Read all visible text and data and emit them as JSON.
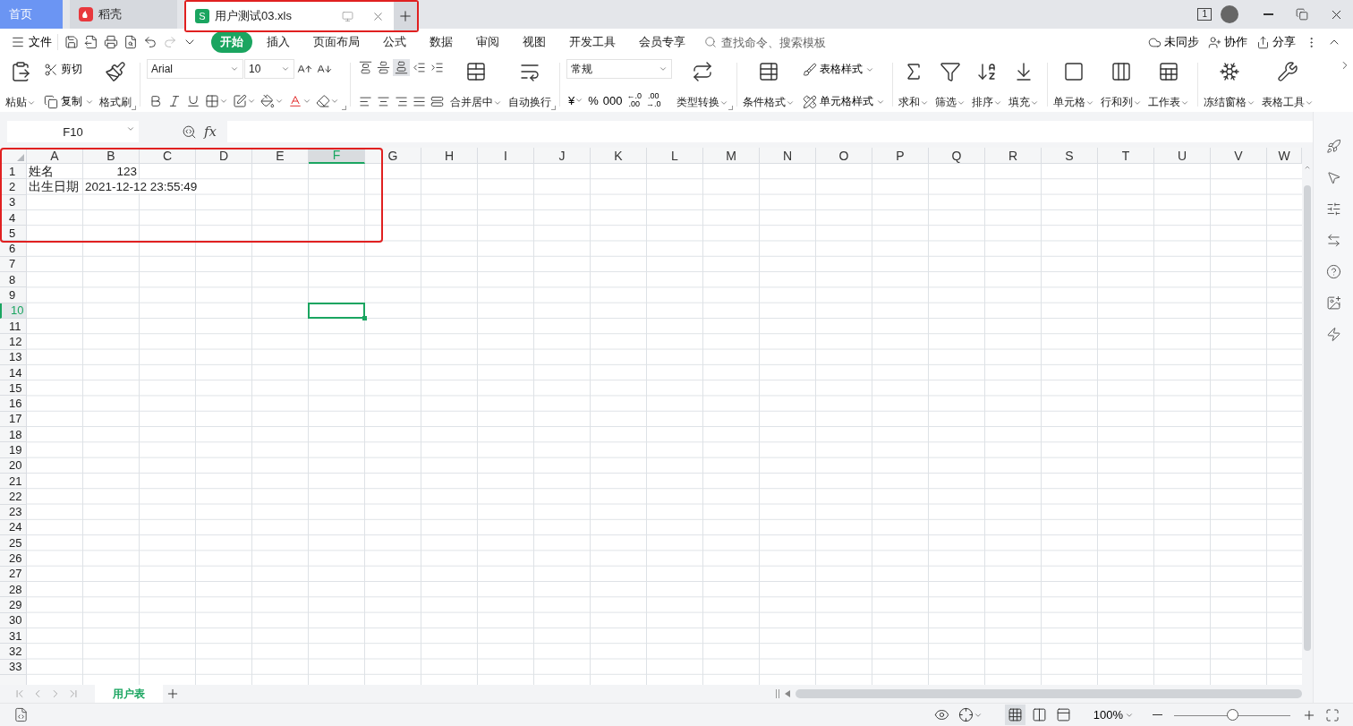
{
  "title_bar": {
    "tabs": [
      {
        "kind": "home",
        "label": "首页",
        "selected": false
      },
      {
        "kind": "docer",
        "label": "稻壳",
        "selected": false
      },
      {
        "kind": "sheet",
        "label": "用户测试03.xls",
        "badge": "S",
        "selected": true
      }
    ],
    "window_count": "1"
  },
  "menu_bar": {
    "file": "文件",
    "quick_access": [
      {
        "disabled": false
      },
      {
        "disabled": false
      },
      {
        "disabled": false
      },
      {
        "disabled": false
      },
      {
        "disabled": false
      },
      {
        "disabled": true
      },
      {
        "disabled": false
      }
    ],
    "tabs": [
      {
        "label": "开始",
        "selected": true
      },
      {
        "label": "插入",
        "selected": false
      },
      {
        "label": "页面布局",
        "selected": false
      },
      {
        "label": "公式",
        "selected": false
      },
      {
        "label": "数据",
        "selected": false
      },
      {
        "label": "审阅",
        "selected": false
      },
      {
        "label": "视图",
        "selected": false
      },
      {
        "label": "开发工具",
        "selected": false
      },
      {
        "label": "会员专享",
        "selected": false
      }
    ],
    "search": {
      "placeholder": "查找命令、搜索模板"
    },
    "actions": [
      {
        "label": "未同步"
      },
      {
        "label": "协作"
      },
      {
        "label": "分享"
      }
    ]
  },
  "ribbon": [
    {
      "kind": "large",
      "label": "粘贴",
      "dropdown": true,
      "launcher": false
    },
    {
      "kind": "pair",
      "items": [
        {
          "label": "剪切",
          "dropdown": false
        },
        {
          "label": "复制",
          "dropdown": true
        }
      ]
    },
    {
      "kind": "large",
      "label": "格式刷",
      "dropdown": false,
      "launcher": true
    },
    {
      "kind": "divider"
    },
    {
      "kind": "font",
      "name": "Arial",
      "size": "10",
      "launcher": true,
      "tools": [
        {
          "dropdown": false
        },
        {
          "dropdown": false
        },
        {
          "dropdown": false
        },
        {
          "dropdown": true
        },
        {
          "dropdown": true
        },
        {
          "dropdown": true
        },
        {
          "dropdown": true
        },
        {
          "dropdown": true
        }
      ]
    },
    {
      "kind": "divider"
    },
    {
      "kind": "align",
      "tools": [
        {
          "selected": false
        },
        {
          "selected": false
        },
        {
          "selected": true
        },
        {
          "selected": false
        },
        {
          "selected": false
        },
        {
          "selected": false
        },
        {
          "selected": false
        },
        {
          "selected": false
        },
        {
          "selected": false
        },
        {
          "selected": false
        }
      ]
    },
    {
      "kind": "large",
      "label": "合并居中",
      "dropdown": true,
      "launcher": false
    },
    {
      "kind": "large",
      "label": "自动换行",
      "dropdown": false,
      "launcher": true
    },
    {
      "kind": "divider"
    },
    {
      "kind": "number",
      "format": "常规",
      "tools": [
        {
          "label": "¥",
          "dropdown": true
        },
        {
          "label": "%",
          "dropdown": false
        },
        {
          "label": "000",
          "dropdown": false
        },
        {
          "label": "←.0",
          "sub": ".00",
          "dropdown": false
        },
        {
          "label": ".00",
          "sub": "→.0",
          "dropdown": false
        }
      ]
    },
    {
      "kind": "large",
      "label": "类型转换",
      "dropdown": true,
      "launcher": true
    },
    {
      "kind": "divider"
    },
    {
      "kind": "large",
      "label": "条件格式",
      "dropdown": true,
      "launcher": false
    },
    {
      "kind": "pair",
      "items": [
        {
          "label": "表格样式",
          "dropdown": true
        },
        {
          "label": "单元格样式",
          "dropdown": true
        }
      ]
    },
    {
      "kind": "divider"
    },
    {
      "kind": "large",
      "label": "求和",
      "dropdown": true,
      "launcher": false
    },
    {
      "kind": "large",
      "label": "筛选",
      "dropdown": true,
      "launcher": false
    },
    {
      "kind": "large",
      "label": "排序",
      "dropdown": true,
      "launcher": false
    },
    {
      "kind": "large",
      "label": "填充",
      "dropdown": true,
      "launcher": false
    },
    {
      "kind": "divider"
    },
    {
      "kind": "large",
      "label": "单元格",
      "dropdown": true,
      "launcher": false
    },
    {
      "kind": "large",
      "label": "行和列",
      "dropdown": true,
      "launcher": false
    },
    {
      "kind": "large",
      "label": "工作表",
      "dropdown": true,
      "launcher": false
    },
    {
      "kind": "divider"
    },
    {
      "kind": "large",
      "label": "冻结窗格",
      "dropdown": true,
      "launcher": false
    },
    {
      "kind": "large",
      "label": "表格工具",
      "dropdown": true,
      "launcher": false
    }
  ],
  "formula_bar": {
    "cell_ref": "F10",
    "fx": "fx"
  },
  "sheet": {
    "columns": [
      {
        "label": "A",
        "selected": false
      },
      {
        "label": "B",
        "selected": false
      },
      {
        "label": "C",
        "selected": false
      },
      {
        "label": "D",
        "selected": false
      },
      {
        "label": "E",
        "selected": false
      },
      {
        "label": "F",
        "selected": true
      },
      {
        "label": "G",
        "selected": false
      },
      {
        "label": "H",
        "selected": false
      },
      {
        "label": "I",
        "selected": false
      },
      {
        "label": "J",
        "selected": false
      },
      {
        "label": "K",
        "selected": false
      },
      {
        "label": "L",
        "selected": false
      },
      {
        "label": "M",
        "selected": false
      },
      {
        "label": "N",
        "selected": false
      },
      {
        "label": "O",
        "selected": false
      },
      {
        "label": "P",
        "selected": false
      },
      {
        "label": "Q",
        "selected": false
      },
      {
        "label": "R",
        "selected": false
      },
      {
        "label": "S",
        "selected": false
      },
      {
        "label": "T",
        "selected": false
      },
      {
        "label": "U",
        "selected": false
      },
      {
        "label": "V",
        "selected": false
      },
      {
        "label": "W",
        "selected": false
      }
    ],
    "rows": [
      {
        "label": "1",
        "selected": false,
        "cells": [
          {
            "text": "姓名",
            "right_aligned": false
          },
          {
            "text": "123",
            "right_aligned": true
          }
        ]
      },
      {
        "label": "2",
        "selected": false,
        "cells": [
          {
            "text": "出生日期",
            "right_aligned": false
          },
          {
            "text": "2021-12-12 23:55:49",
            "right_aligned": false
          }
        ]
      },
      {
        "label": "3",
        "selected": false
      },
      {
        "label": "4",
        "selected": false
      },
      {
        "label": "5",
        "selected": false
      },
      {
        "label": "6",
        "selected": false
      },
      {
        "label": "7",
        "selected": false
      },
      {
        "label": "8",
        "selected": false
      },
      {
        "label": "9",
        "selected": false
      },
      {
        "label": "10",
        "selected": true
      },
      {
        "label": "11",
        "selected": false
      },
      {
        "label": "12",
        "selected": false
      },
      {
        "label": "13",
        "selected": false
      },
      {
        "label": "14",
        "selected": false
      },
      {
        "label": "15",
        "selected": false
      },
      {
        "label": "16",
        "selected": false
      },
      {
        "label": "17",
        "selected": false
      },
      {
        "label": "18",
        "selected": false
      },
      {
        "label": "19",
        "selected": false
      },
      {
        "label": "20",
        "selected": false
      },
      {
        "label": "21",
        "selected": false
      },
      {
        "label": "22",
        "selected": false
      },
      {
        "label": "23",
        "selected": false
      },
      {
        "label": "24",
        "selected": false
      },
      {
        "label": "25",
        "selected": false
      },
      {
        "label": "26",
        "selected": false
      },
      {
        "label": "27",
        "selected": false
      },
      {
        "label": "28",
        "selected": false
      },
      {
        "label": "29",
        "selected": false
      },
      {
        "label": "30",
        "selected": false
      },
      {
        "label": "31",
        "selected": false
      },
      {
        "label": "32",
        "selected": false
      },
      {
        "label": "33",
        "selected": false
      }
    ]
  },
  "sheet_tabs": [
    {
      "label": "用户表",
      "selected": true
    }
  ],
  "status_bar": {
    "views": [
      {
        "selected": true
      },
      {
        "selected": false
      },
      {
        "selected": false
      }
    ],
    "zoom": "100%",
    "zoom_slider": {
      "level": 0.5
    }
  }
}
